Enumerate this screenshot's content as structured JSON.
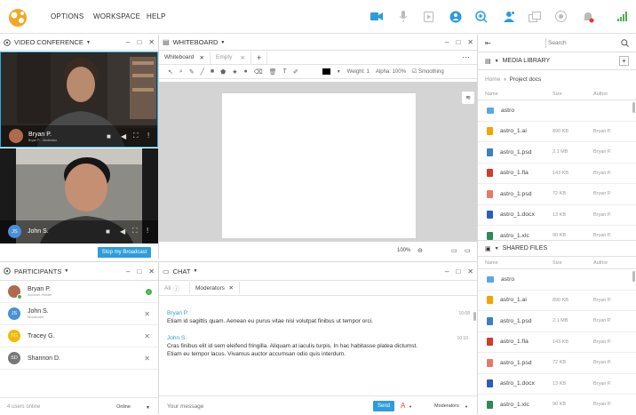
{
  "menu": {
    "options": "OPTIONS",
    "workspace": "WORKSPACE",
    "help": "HELP"
  },
  "video": {
    "title": "VIDEO CONFERENCE",
    "p1": "Bryan P.",
    "p1_sub": "Bryan P. - Moderator",
    "p2": "John S.",
    "p2_initials": "JS",
    "broadcast": "Stop my Broadcast"
  },
  "whiteboard": {
    "title": "WHITEBOARD",
    "tabs": [
      "Whiteboard",
      "Empty"
    ],
    "weight": "Weight: 1",
    "alpha": "Alpha: 100%",
    "smoothing": "Smoothing",
    "zoom": "100%"
  },
  "participants": {
    "title": "PARTICIPANTS",
    "list": [
      {
        "name": "Bryan P.",
        "sub": "Account Holder",
        "initials": "",
        "color": "#b06a4e"
      },
      {
        "name": "John S.",
        "sub": "Moderator",
        "initials": "JS",
        "color": "#4a90d9"
      },
      {
        "name": "Tracey G.",
        "sub": "",
        "initials": "TG",
        "color": "#f5b800"
      },
      {
        "name": "Shannon D.",
        "sub": "",
        "initials": "SD",
        "color": "#777777"
      }
    ],
    "online": "4 users online",
    "status": "Online"
  },
  "chat": {
    "title": "CHAT",
    "tabs": [
      "All",
      "Moderators"
    ],
    "messages": [
      {
        "author": "Bryan P.",
        "time": "10:08",
        "text": "Etiam id sagittis quam. Aenean eu purus vitae nisi volutpat finibus ut tempor orci."
      },
      {
        "author": "John S.",
        "time": "10:10",
        "text": "Cras finibus elit id sem eleifend fringilla. Aliquam at iaculis turpis. In hac habitasse platea dictumst. Etiam eu tempor lacus. Vivamus auctor accumsan odio quis interdum."
      }
    ],
    "placeholder": "Your message",
    "send": "Send",
    "recipient": "Moderators"
  },
  "media": {
    "search": "Search",
    "title": "MEDIA LIBRARY",
    "crumb_home": "Home",
    "crumb_current": "Project docs",
    "cols": [
      "Name",
      "Size",
      "Author"
    ],
    "files": [
      {
        "name": "astro",
        "size": "",
        "author": "",
        "color": "#5aa9e6",
        "type": "folder"
      },
      {
        "name": "astro_1.ai",
        "size": "890 KB",
        "author": "Bryan P.",
        "color": "#f0a500",
        "type": "file"
      },
      {
        "name": "astro_1.psd",
        "size": "2.1 MB",
        "author": "Bryan P.",
        "color": "#3b7fc4",
        "type": "file"
      },
      {
        "name": "astro_1.fla",
        "size": "143 KB",
        "author": "Bryan P.",
        "color": "#d33b2c",
        "type": "file"
      },
      {
        "name": "astro_1.psd",
        "size": "72 KB",
        "author": "Bryan P.",
        "color": "#e67a6a",
        "type": "file"
      },
      {
        "name": "astro_1.docx",
        "size": "13 KB",
        "author": "Bryan P.",
        "color": "#2b5eb5",
        "type": "file"
      },
      {
        "name": "astro_1.xlc",
        "size": "90 KB",
        "author": "Bryan P.",
        "color": "#2e8b57",
        "type": "file"
      }
    ],
    "shared_title": "SHARED FILES",
    "shared": [
      {
        "name": "astro",
        "size": "",
        "author": "",
        "color": "#5aa9e6",
        "type": "folder"
      },
      {
        "name": "astro_1.ai",
        "size": "890 KB",
        "author": "Bryan P.",
        "color": "#f0a500",
        "type": "file"
      },
      {
        "name": "astro_1.psd",
        "size": "2.1 MB",
        "author": "Bryan P.",
        "color": "#3b7fc4",
        "type": "file"
      },
      {
        "name": "astro_1.fla",
        "size": "143 KB",
        "author": "Bryan P.",
        "color": "#d33b2c",
        "type": "file"
      },
      {
        "name": "astro_1.psd",
        "size": "72 KB",
        "author": "Bryan P.",
        "color": "#e67a6a",
        "type": "file"
      },
      {
        "name": "astro_1.docx",
        "size": "13 KB",
        "author": "Bryan P.",
        "color": "#2b5eb5",
        "type": "file"
      },
      {
        "name": "astro_1.xlc",
        "size": "90 KB",
        "author": "Bryan P.",
        "color": "#2e8b57",
        "type": "file"
      }
    ]
  },
  "colors": {
    "accent": "#2d9cdb",
    "notify": "#e53935",
    "online": "#4caf50",
    "logo": "#f5a623"
  }
}
